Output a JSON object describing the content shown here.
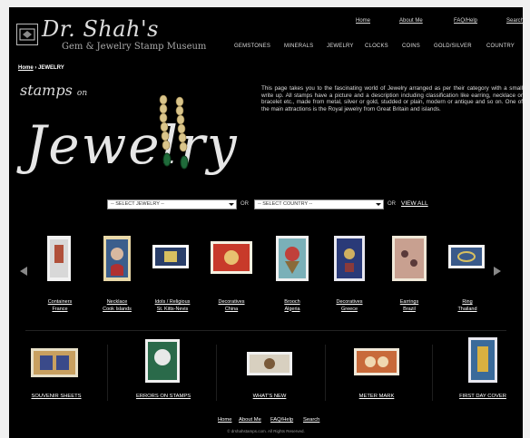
{
  "header": {
    "title": "Dr. Shah's",
    "subtitle": "Gem & Jewelry Stamp Museum",
    "top_links": [
      "Home",
      "About Me",
      "FAQ/Help",
      "Search"
    ],
    "nav": [
      "GEMSTONES",
      "MINERALS",
      "JEWELRY",
      "CLOCKS",
      "COINS",
      "GOLD/SILVER",
      "COUNTRY"
    ]
  },
  "breadcrumb": {
    "home": "Home",
    "sep": "›",
    "current": "JEWELRY"
  },
  "hero": {
    "line1": "stamps",
    "line1_suffix": "on",
    "line2": "Jewelry",
    "intro": "This page takes you to the fascinating world of Jewelry arranged as per their category with a small write up. All stamps have a picture and a description including classification like earring, necklace or bracelet etc., made from metal, silver or gold, studded or plain, modern or antique and so on. One of the main attractions is the Royal jewelry from Great Britain and islands."
  },
  "filters": {
    "jewelry_select": "-- SELECT JEWELRY --",
    "or1": "OR",
    "country_select": "-- SELECT COUNTRY --",
    "or2": "OR",
    "view_all": "VIEW ALL"
  },
  "carousel": [
    {
      "line1": "Containers",
      "line2": "France"
    },
    {
      "line1": "Necklace",
      "line2": "Cook Islands"
    },
    {
      "line1": "Idols / Religious",
      "line2": "St. Kitts-Nevis"
    },
    {
      "line1": "Decoratives",
      "line2": "China"
    },
    {
      "line1": "Brooch",
      "line2": "Algeria"
    },
    {
      "line1": "Decoratives",
      "line2": "Greece"
    },
    {
      "line1": "Earrings",
      "line2": "Brazil"
    },
    {
      "line1": "Ring",
      "line2": "Thailand"
    }
  ],
  "sections": [
    "SOUVENIR SHEETS",
    "ERRORS ON STAMPS",
    "WHAT'S NEW",
    "METER MARK",
    "FIRST DAY COVER"
  ],
  "footer": {
    "links": [
      "Home",
      "About Me",
      "FAQ/Help",
      "Search"
    ],
    "copyright": "© drshahstamps.com. All Rights Reserved."
  },
  "colors": {
    "background": "#000000",
    "text": "#ffffff",
    "page_bg": "#f0f0f0"
  }
}
